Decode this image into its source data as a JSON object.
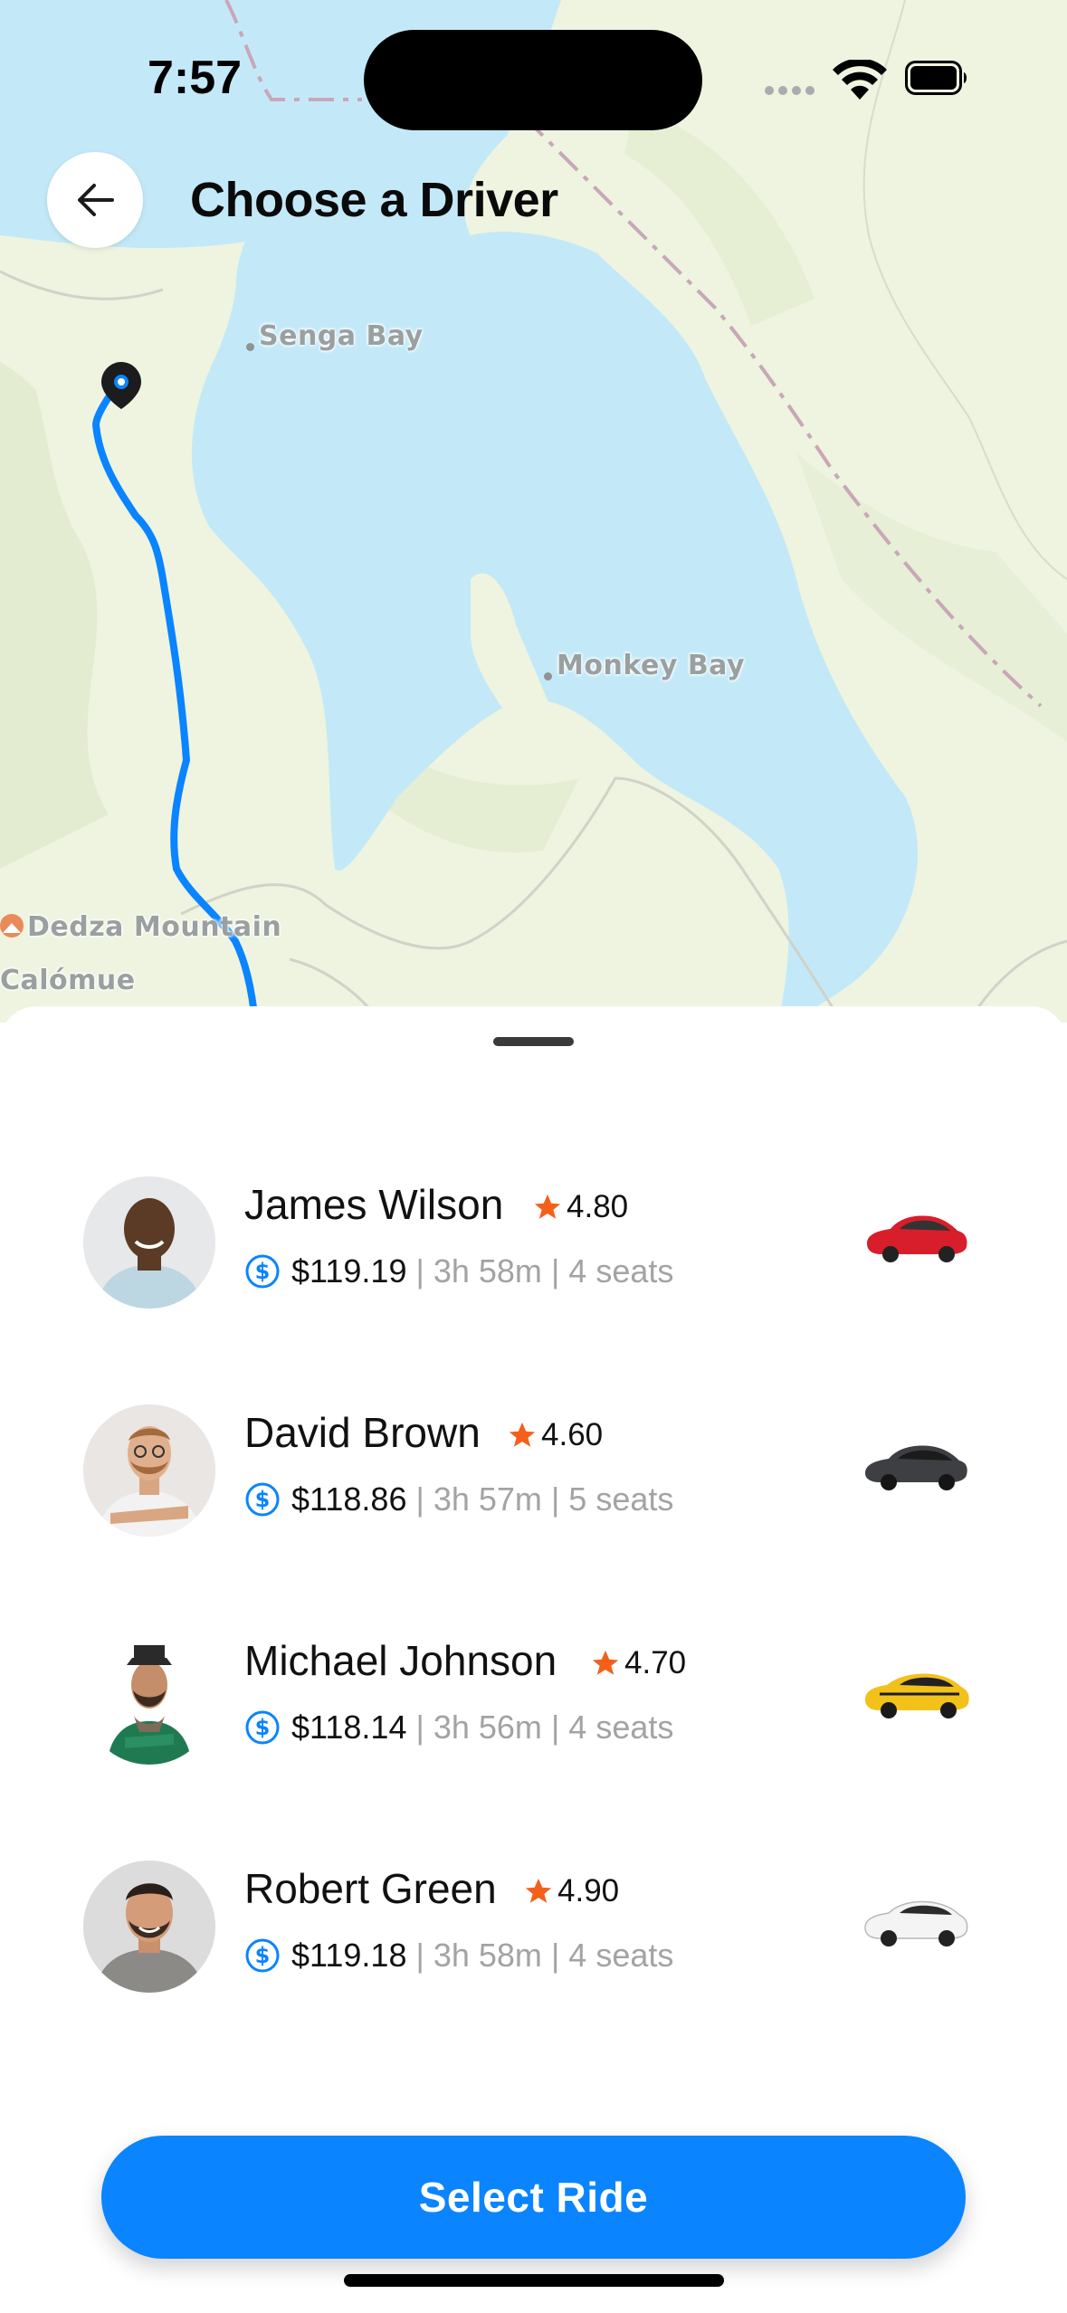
{
  "status_bar": {
    "time": "7:57"
  },
  "header": {
    "title": "Choose a Driver"
  },
  "map": {
    "labels": {
      "senga_bay": "Senga Bay",
      "monkey_bay": "Monkey Bay",
      "dedza_mountain": "Dedza Mountain",
      "calomue": "Calómue"
    },
    "route_color": "#0a84ff",
    "water_color": "#c3e9f8",
    "land_color": "#eef4df"
  },
  "drivers": [
    {
      "name": "James Wilson",
      "rating": "4.80",
      "price": "$119.19",
      "duration": "3h 58m",
      "seats": "4 seats",
      "car_color": "red"
    },
    {
      "name": "David Brown",
      "rating": "4.60",
      "price": "$118.86",
      "duration": "3h 57m",
      "seats": "5 seats",
      "car_color": "dark gray"
    },
    {
      "name": "Michael Johnson",
      "rating": "4.70",
      "price": "$118.14",
      "duration": "3h 56m",
      "seats": "4 seats",
      "car_color": "yellow"
    },
    {
      "name": "Robert Green",
      "rating": "4.90",
      "price": "$119.18",
      "duration": "3h 58m",
      "seats": "4 seats",
      "car_color": "white"
    }
  ],
  "separator": "|",
  "cta": {
    "label": "Select Ride"
  },
  "colors": {
    "accent": "#0a84ff",
    "star": "#f4601a",
    "muted_text": "#a3a3a3"
  }
}
